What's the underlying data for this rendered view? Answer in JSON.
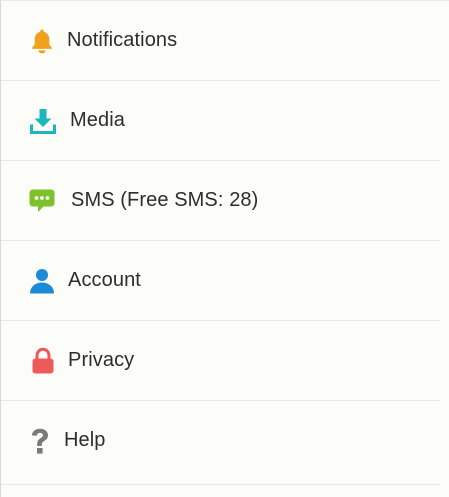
{
  "menu": {
    "items": [
      {
        "id": "notifications",
        "label": "Notifications",
        "icon": "bell-icon",
        "color": "#f0a21d"
      },
      {
        "id": "media",
        "label": "Media",
        "icon": "download-icon",
        "color": "#1cb6bd"
      },
      {
        "id": "sms",
        "label": "SMS (Free SMS: 28)",
        "icon": "chat-bubble-icon",
        "color": "#7dc12b"
      },
      {
        "id": "account",
        "label": "Account",
        "icon": "person-icon",
        "color": "#1b8ad8"
      },
      {
        "id": "privacy",
        "label": "Privacy",
        "icon": "lock-icon",
        "color": "#ee5a5a"
      },
      {
        "id": "help",
        "label": "Help",
        "icon": "question-mark-icon",
        "color": "#7a7a7a"
      }
    ]
  }
}
